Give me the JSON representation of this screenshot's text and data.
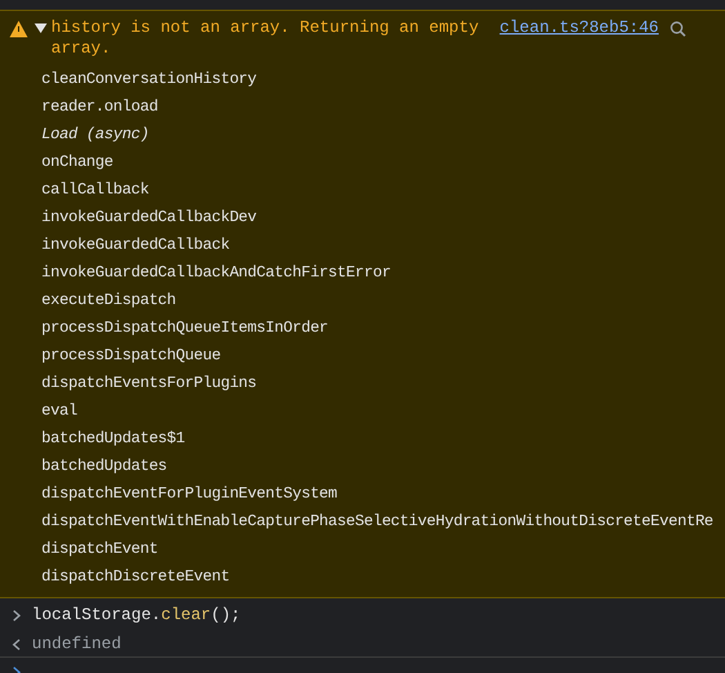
{
  "warning": {
    "message": "history is not an array. Returning an empty array.",
    "expanded": true,
    "source": "clean.ts?8eb5:46",
    "frames": [
      {
        "name": "cleanConversationHistory",
        "kind": "call"
      },
      {
        "name": "reader.onload",
        "kind": "call"
      },
      {
        "name": "Load (async)",
        "kind": "async"
      },
      {
        "name": "onChange",
        "kind": "call"
      },
      {
        "name": "callCallback",
        "kind": "call"
      },
      {
        "name": "invokeGuardedCallbackDev",
        "kind": "call"
      },
      {
        "name": "invokeGuardedCallback",
        "kind": "call"
      },
      {
        "name": "invokeGuardedCallbackAndCatchFirstError",
        "kind": "call"
      },
      {
        "name": "executeDispatch",
        "kind": "call"
      },
      {
        "name": "processDispatchQueueItemsInOrder",
        "kind": "call"
      },
      {
        "name": "processDispatchQueue",
        "kind": "call"
      },
      {
        "name": "dispatchEventsForPlugins",
        "kind": "call"
      },
      {
        "name": "eval",
        "kind": "call"
      },
      {
        "name": "batchedUpdates$1",
        "kind": "call"
      },
      {
        "name": "batchedUpdates",
        "kind": "call"
      },
      {
        "name": "dispatchEventForPluginEventSystem",
        "kind": "call"
      },
      {
        "name": "dispatchEventWithEnableCapturePhaseSelectiveHydrationWithoutDiscreteEventRe",
        "kind": "call"
      },
      {
        "name": "dispatchEvent",
        "kind": "call"
      },
      {
        "name": "dispatchDiscreteEvent",
        "kind": "call"
      }
    ]
  },
  "input": {
    "object": "localStorage",
    "dot": ".",
    "method": "clear",
    "rest": "();"
  },
  "result": "undefined"
}
